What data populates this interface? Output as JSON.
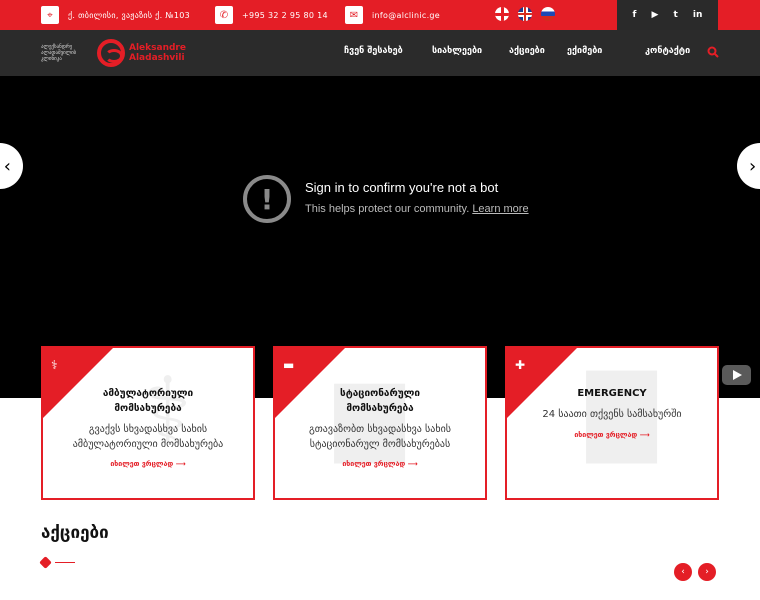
{
  "topbar": {
    "address": "ქ. თბილისი, ვაჟაზის ქ. №103",
    "address_icon": "map-pin-icon",
    "phone": "+995 32 2 95 80 14",
    "phone_icon": "phone-icon",
    "email": "info@alclinic.ge",
    "email_icon": "envelope-icon",
    "languages": [
      "ka",
      "en",
      "ru"
    ],
    "social": [
      "f",
      "▶",
      "t",
      "in"
    ],
    "accent_color": "#e41e26"
  },
  "logo": {
    "georgian_text": "ალექსანდრე ალადაშვილის კლინიკა",
    "english_line1": "Aleksandre",
    "english_line2": "Aladashvili"
  },
  "nav": {
    "items": [
      "ჩვენ შესახებ",
      "სიახლეები",
      "აქციები",
      "ექიმები",
      "კონტაქტი"
    ]
  },
  "video": {
    "title": "Sign in to confirm you're not a bot",
    "subtitle": "This helps protect our community.",
    "link": "Learn more"
  },
  "services": [
    {
      "icon": "stethoscope-icon",
      "title_line1": "ამბულატორიული",
      "title_line2": "მომსახურება",
      "desc_line1": "გვაქვს სხვადასხვა სახის",
      "desc_line2": "ამბულატორიული მომსახურება",
      "link": "იხილეთ ვრცლად ⟶"
    },
    {
      "icon": "bed-icon",
      "title_line1": "სტაციონარული",
      "title_line2": "მომსახურება",
      "desc_line1": "გთავაზობთ სხვადასხვა სახის",
      "desc_line2": "სტაციონარულ მომსახურებას",
      "link": "იხილეთ ვრცლად ⟶"
    },
    {
      "icon": "ambulance-icon",
      "title_line1": "EMERGENCY",
      "title_line2": "",
      "desc_line1": "24 საათი თქვენს სამსახურში",
      "desc_line2": "",
      "link": "იხილეთ ვრცლად ⟶"
    }
  ],
  "promotions": {
    "title": "აქციები"
  }
}
